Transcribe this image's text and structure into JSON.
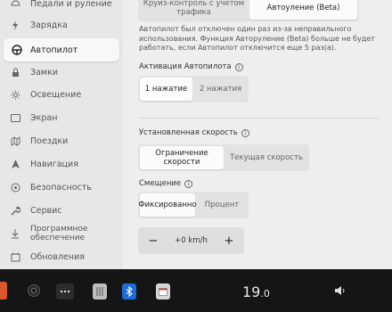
{
  "sidebar": {
    "items": [
      {
        "label": "Педали и руление",
        "icon": "car-icon"
      },
      {
        "label": "Зарядка",
        "icon": "charging-bolt-icon"
      },
      {
        "label": "Автопилот",
        "icon": "steering-wheel-icon",
        "active": true
      },
      {
        "label": "Замки",
        "icon": "lock-icon"
      },
      {
        "label": "Освещение",
        "icon": "sun-icon"
      },
      {
        "label": "Экран",
        "icon": "display-icon"
      },
      {
        "label": "Поездки",
        "icon": "trips-icon"
      },
      {
        "label": "Навигация",
        "icon": "navigation-arrow-icon"
      },
      {
        "label": "Безопасность",
        "icon": "security-icon"
      },
      {
        "label": "Сервис",
        "icon": "wrench-icon"
      },
      {
        "label_line1": "Программное",
        "label_line2": "обеспечение",
        "icon": "download-icon"
      },
      {
        "label": "Обновления",
        "icon": "updates-icon"
      }
    ]
  },
  "mode_toggle": {
    "options": [
      {
        "label": "Круиз-контроль с учетом трафика",
        "selected": false
      },
      {
        "label": "Автоуление (Beta)",
        "selected": true
      }
    ]
  },
  "notice": "Автопилот был отключен один раз из-за неправильного использования. Функция Авторуление (Beta) больше не будет работать, если Автопилот отключится еще 5 раз(а).",
  "activation": {
    "title": "Активация Автопилота",
    "options": [
      {
        "label": "1 нажатие",
        "selected": true
      },
      {
        "label": "2 нажатия",
        "selected": false
      }
    ]
  },
  "set_speed": {
    "title": "Установленная скорость",
    "options": [
      {
        "label": "Ограничение скорости",
        "selected": true
      },
      {
        "label": "Текущая скорость",
        "selected": false
      }
    ]
  },
  "offset": {
    "title": "Смещение",
    "options": [
      {
        "label": "Фиксированно",
        "selected": true
      },
      {
        "label": "Процент",
        "selected": false
      }
    ],
    "minus": "−",
    "value": "+0 km/h",
    "plus": "+"
  },
  "taskbar": {
    "temperature_main": "19",
    "temperature_decimal": ".0",
    "icons": [
      "orange-app-icon",
      "camera-icon",
      "more-dots-icon",
      "app-icon",
      "bluetooth-icon",
      "calendar-icon",
      "volume-icon"
    ],
    "colors": {
      "bluetooth": "#1e6bd6",
      "orange_app": "#d9572b",
      "background": "#151515"
    }
  }
}
